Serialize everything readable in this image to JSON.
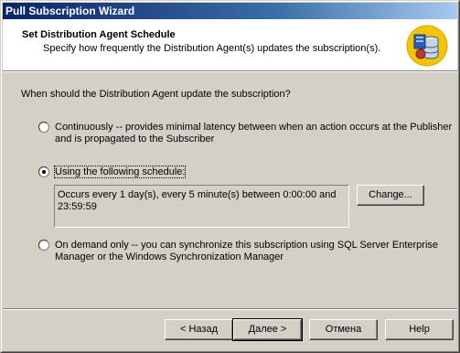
{
  "window": {
    "title": "Pull Subscription Wizard"
  },
  "header": {
    "title": "Set Distribution Agent Schedule",
    "subtitle": "Specify how frequently the Distribution Agent(s) updates the subscription(s).",
    "icon": "database-subscription-icon"
  },
  "main": {
    "question": "When should the Distribution Agent update the subscription?",
    "options": [
      {
        "label_line1": "Continuously -- provides minimal latency between when an action occurs at the Publisher",
        "label_line2": "and is propagated to the Subscriber",
        "selected": false
      },
      {
        "label_line1": "Using the following schedule:",
        "selected": true
      },
      {
        "label_line1": "On demand only -- you can synchronize this subscription using SQL Server Enterprise",
        "label_line2": "Manager or the Windows Synchronization Manager",
        "selected": false
      }
    ],
    "schedule": {
      "line1": "Occurs every 1 day(s), every 5 minute(s) between 0:00:00 and",
      "line2": "23:59:59"
    },
    "change_button": "Change..."
  },
  "footer": {
    "back": "< Назад",
    "next": "Далее >",
    "cancel": "Отмена",
    "help": "Help"
  },
  "colors": {
    "title_start": "#0a246a",
    "title_end": "#a6caf0",
    "face": "#d4d0c8"
  }
}
